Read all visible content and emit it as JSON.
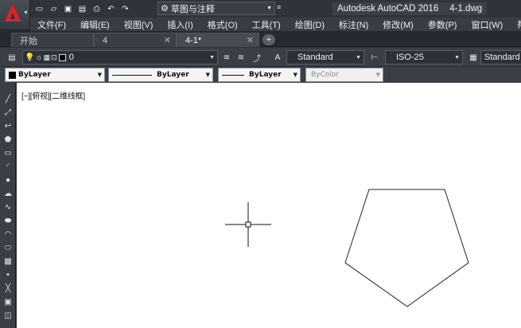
{
  "app": {
    "title": "Autodesk AutoCAD 2016",
    "file": "4-1.dwg",
    "workspace": "草图与注释"
  },
  "menu": [
    "文件(F)",
    "编辑(E)",
    "视图(V)",
    "插入(I)",
    "格式(O)",
    "工具(T)",
    "绘图(D)",
    "标注(N)",
    "修改(M)",
    "参数(P)",
    "窗口(W)",
    "帮助("
  ],
  "tabs": [
    {
      "label": "开始"
    },
    {
      "label": "4"
    },
    {
      "label": "4-1*"
    }
  ],
  "layer": {
    "current": "0",
    "text_style": "Standard",
    "dim_style": "ISO-25",
    "table_style": "Standard"
  },
  "properties": {
    "color": "ByLayer",
    "linetype": "ByLayer",
    "lineweight": "ByLayer",
    "plotstyle": "ByColor"
  },
  "viewport": {
    "label": "[−][俯视][二维线框]"
  },
  "colors": {
    "accent_red": "#d8242b",
    "canvas_bg": "#ffffff",
    "chrome_bg": "#3a3e46"
  },
  "icons": {
    "qat": [
      "new-icon",
      "open-icon",
      "save-icon",
      "save-as-icon",
      "print-icon",
      "undo-icon",
      "redo-icon"
    ],
    "left_tools": [
      "line-icon",
      "construction-line-icon",
      "polyline-icon",
      "polygon-icon",
      "rectangle-icon",
      "arc-icon",
      "circle-icon",
      "revision-cloud-icon",
      "spline-icon",
      "ellipse-icon",
      "ellipse-arc-icon",
      "insert-block-icon",
      "make-block-icon",
      "point-icon",
      "hatch-icon",
      "gradient-icon",
      "region-icon",
      "table-icon"
    ]
  }
}
